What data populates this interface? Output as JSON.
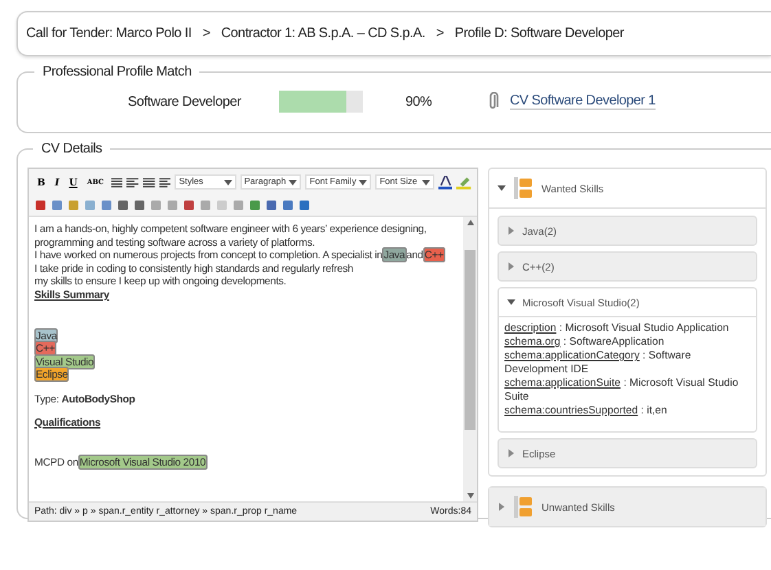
{
  "breadcrumb": [
    {
      "label": "Call for Tender: Marco Polo II"
    },
    {
      "label": "Contractor 1: AB S.p.A. – CD S.p.A."
    },
    {
      "label": "Profile D: Software Developer"
    }
  ],
  "breadcrumb_separators": [
    ">",
    ">"
  ],
  "profile_match": {
    "title": "Professional Profile Match",
    "profile": "Software Developer",
    "level": 0.8,
    "percent": "90%",
    "cv_link": "CV Software Developer 1"
  },
  "cv_details": {
    "title": "CV Details",
    "toolbar": {
      "format_buttons": [
        "B",
        "I",
        "U",
        "ABC"
      ],
      "dropdowns": [
        "Styles",
        "Paragraph",
        "Font Family",
        "Font Size"
      ]
    },
    "content": [
      {
        "kind": "line",
        "segments": [
          {
            "text": "I am a hands-on, highly competent software engineer with 6 years’ experience designing,"
          }
        ]
      },
      {
        "kind": "line",
        "segments": [
          {
            "text": "programming and testing software across a variety of platforms."
          }
        ]
      },
      {
        "kind": "line",
        "segments": [
          {
            "text": "I have worked on numerous projects from concept to completion. A specialist in"
          },
          {
            "text": "Java",
            "color": "#8fa79e"
          },
          {
            "text": "and"
          },
          {
            "text": "C++",
            "color": "#e8604c"
          }
        ]
      },
      {
        "kind": "line",
        "segments": [
          {
            "text": "I take pride in coding to consistently high standards and regularly refresh"
          }
        ]
      },
      {
        "kind": "line",
        "segments": [
          {
            "text": "my skills to ensure I keep up with ongoing developments."
          }
        ]
      },
      {
        "kind": "heading",
        "text": "Skills Summary"
      },
      {
        "kind": "tag",
        "text": "Java",
        "color": "#a8c3cc"
      },
      {
        "kind": "tag",
        "text": "C++",
        "color": "#e46a5c"
      },
      {
        "kind": "tag",
        "text": "Visual Studio",
        "color": "#a3c98a"
      },
      {
        "kind": "tag",
        "text": "Eclipse",
        "color": "#f2a42a"
      },
      {
        "kind": "rich",
        "text": "Type: **AutoBodyShop**"
      },
      {
        "kind": "heading",
        "text": "Qualifications"
      },
      {
        "kind": "line",
        "segments": [
          {
            "text": "MCPD on"
          },
          {
            "text": "Microsoft Visual Studio 2010",
            "color": "#a3c98a"
          }
        ]
      }
    ],
    "status_path": "Path: div » p » span.r_entity r_attorney » span.r_prop r_name",
    "word_count": "Words:84"
  },
  "skills_panel": [
    {
      "title": "Wanted Skills",
      "expanded": true,
      "groups": [
        {
          "label": "Java(2)",
          "expanded": false
        },
        {
          "label": "C++(2)",
          "expanded": false
        },
        {
          "label": "Microsoft Visual Studio(2)",
          "expanded": true,
          "properties": [
            {
              "key": "description",
              "separator": ":",
              "value": "Microsoft Visual Studio Application"
            },
            {
              "key": "schema.org",
              "separator": ":",
              "value": "SoftwareApplication"
            },
            {
              "key": "schema:applicationCategory",
              "separator": ":",
              "value": "Software Development IDE"
            },
            {
              "key": "schema:applicationSuite",
              "separator": ":",
              "value": "Microsoft Visual Studio Suite"
            },
            {
              "key": "schema:countriesSupported",
              "separator": ":",
              "value": "it,en"
            }
          ]
        },
        {
          "label": "Eclipse",
          "expanded": false
        }
      ]
    },
    {
      "title": "Unwanted Skills",
      "expanded": false
    }
  ]
}
